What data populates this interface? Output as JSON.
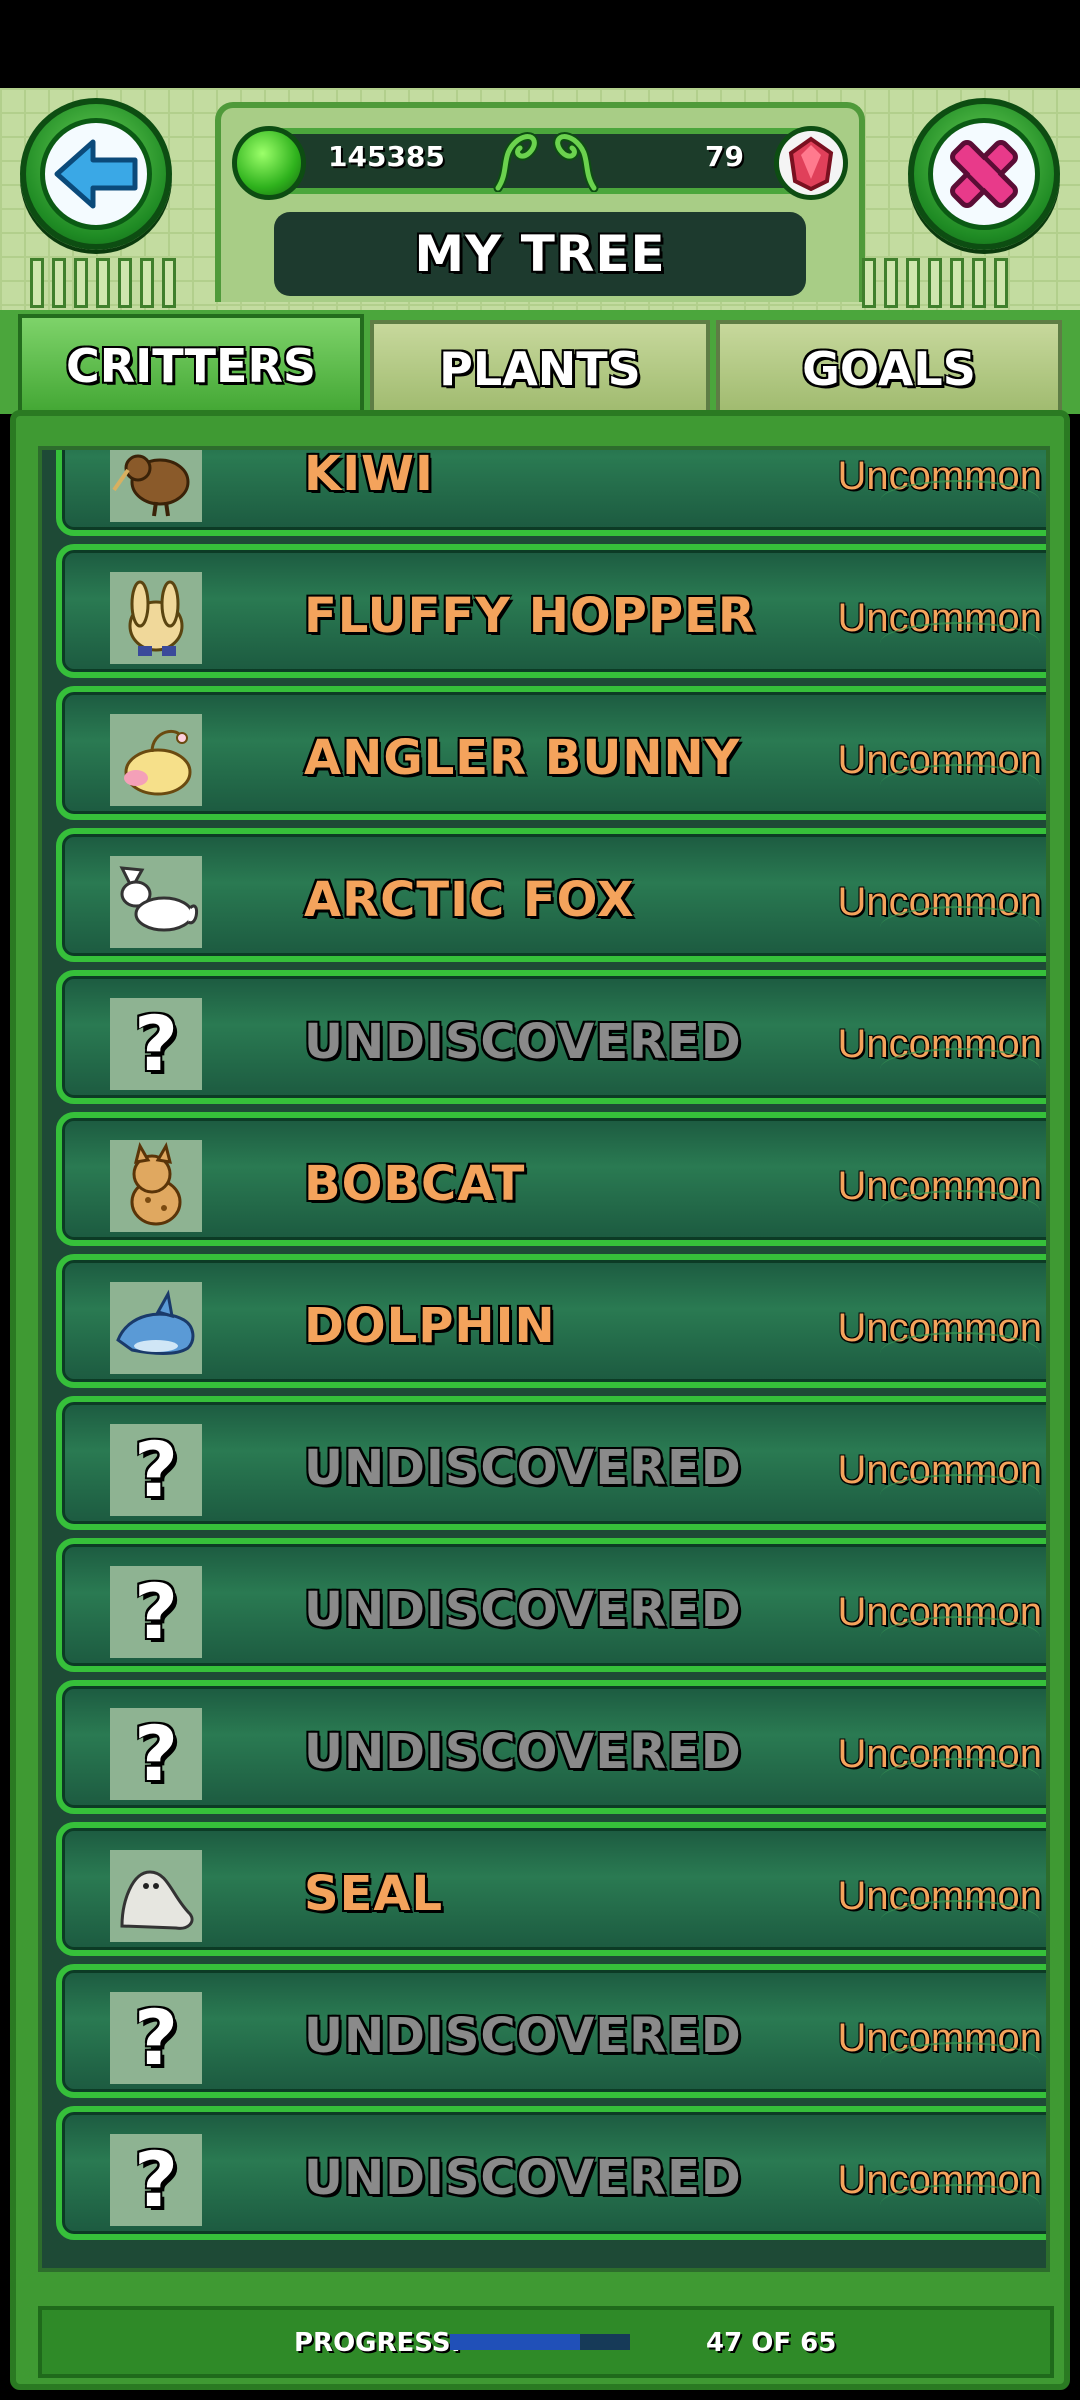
{
  "header": {
    "title": "MY TREE",
    "coins": "145385",
    "gems": "79"
  },
  "tabs": [
    {
      "label": "CRITTERS",
      "active": true
    },
    {
      "label": "PLANTS",
      "active": false
    },
    {
      "label": "GOALS",
      "active": false
    }
  ],
  "critters": [
    {
      "name": "KIWI",
      "rarity": "Uncommon",
      "discovered": true,
      "icon": "kiwi-icon"
    },
    {
      "name": "FLUFFY HOPPER",
      "rarity": "Uncommon",
      "discovered": true,
      "icon": "fluffy-hopper-icon"
    },
    {
      "name": "ANGLER BUNNY",
      "rarity": "Uncommon",
      "discovered": true,
      "icon": "angler-bunny-icon"
    },
    {
      "name": "ARCTIC FOX",
      "rarity": "Uncommon",
      "discovered": true,
      "icon": "arctic-fox-icon"
    },
    {
      "name": "UNDISCOVERED",
      "rarity": "Uncommon",
      "discovered": false,
      "icon": "question-mark-icon"
    },
    {
      "name": "BOBCAT",
      "rarity": "Uncommon",
      "discovered": true,
      "icon": "bobcat-icon"
    },
    {
      "name": "DOLPHIN",
      "rarity": "Uncommon",
      "discovered": true,
      "icon": "dolphin-icon"
    },
    {
      "name": "UNDISCOVERED",
      "rarity": "Uncommon",
      "discovered": false,
      "icon": "question-mark-icon"
    },
    {
      "name": "UNDISCOVERED",
      "rarity": "Uncommon",
      "discovered": false,
      "icon": "question-mark-icon"
    },
    {
      "name": "UNDISCOVERED",
      "rarity": "Uncommon",
      "discovered": false,
      "icon": "question-mark-icon"
    },
    {
      "name": "SEAL",
      "rarity": "Uncommon",
      "discovered": true,
      "icon": "seal-icon"
    },
    {
      "name": "UNDISCOVERED",
      "rarity": "Uncommon",
      "discovered": false,
      "icon": "question-mark-icon"
    },
    {
      "name": "UNDISCOVERED",
      "rarity": "Uncommon",
      "discovered": false,
      "icon": "question-mark-icon"
    }
  ],
  "progress": {
    "label": "PROGRESS:",
    "count_text": "47 OF 65",
    "fraction": 0.723
  },
  "colors": {
    "known_name": "#f4a35c",
    "unknown_name": "#8a8a8a",
    "row_border": "#36c03a",
    "progress_fill": "#2050b8"
  }
}
